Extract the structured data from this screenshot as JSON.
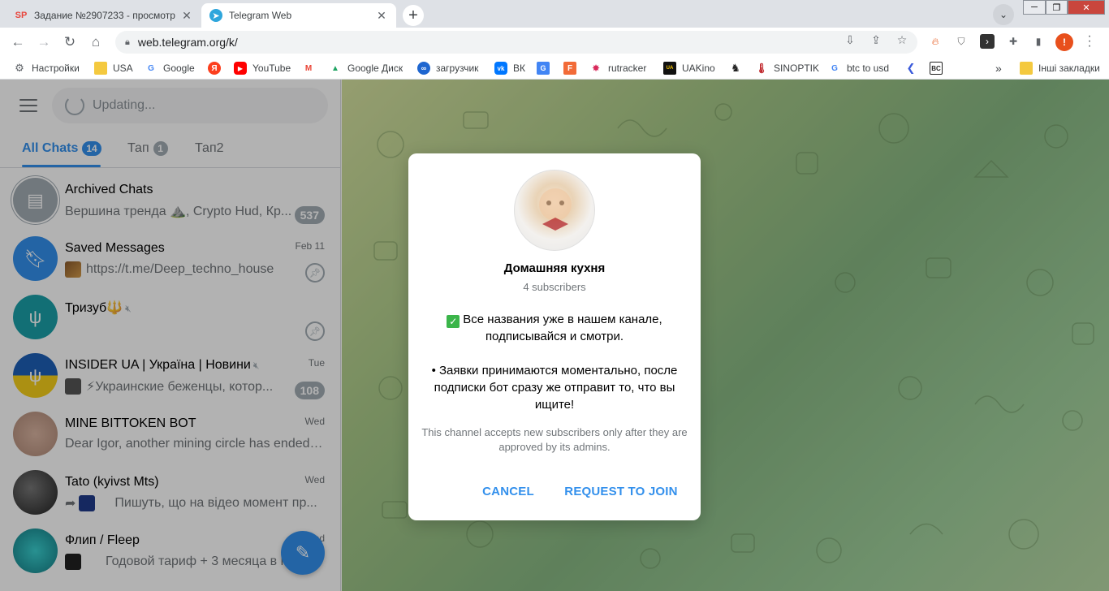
{
  "browser": {
    "tabs": [
      {
        "favicon": "SP",
        "title": "Задание №2907233 - просмотр",
        "active": false
      },
      {
        "favicon": "telegram-icon",
        "title": "Telegram Web",
        "active": true
      }
    ],
    "url": "web.telegram.org/k/",
    "profile_initial": "!",
    "bookmarks": [
      {
        "icon": "gear-icon",
        "label": "Настройки"
      },
      {
        "icon": "folder-icon",
        "label": "USA"
      },
      {
        "icon": "google-icon",
        "label": "Google"
      },
      {
        "icon": "yandex-icon",
        "label": ""
      },
      {
        "icon": "youtube-icon",
        "label": "YouTube"
      },
      {
        "icon": "gmail-icon",
        "label": ""
      },
      {
        "icon": "drive-icon",
        "label": "Google Диск"
      },
      {
        "icon": "loader-icon",
        "label": "загрузчик"
      },
      {
        "icon": "vk-icon",
        "label": "ВК"
      },
      {
        "icon": "translate-icon",
        "label": ""
      },
      {
        "icon": "f-icon",
        "label": ""
      },
      {
        "icon": "rutracker-icon",
        "label": "rutracker"
      },
      {
        "icon": "uakino-icon",
        "label": "UAKino"
      },
      {
        "icon": "chess-icon",
        "label": ""
      },
      {
        "icon": "thermometer-icon",
        "label": "SINOPTIK"
      },
      {
        "icon": "google-icon",
        "label": "btc to usd"
      },
      {
        "icon": "arrow-icon",
        "label": ""
      },
      {
        "icon": "bc-icon",
        "label": "BC"
      }
    ],
    "other_bookmarks": "Інші закладки"
  },
  "sidebar": {
    "search_placeholder": "Updating...",
    "folders": [
      {
        "label": "All Chats",
        "badge": "14",
        "active": true
      },
      {
        "label": "Тап",
        "badge": "1",
        "active": false
      },
      {
        "label": "Тап2",
        "badge": "",
        "active": false
      }
    ],
    "chats": [
      {
        "name": "Archived Chats",
        "preview": "Вершина тренда ⛰️, Crypto Hud, Кр...",
        "time": "",
        "count": "537",
        "pinned": false,
        "avatar_color": "#a2acb4"
      },
      {
        "name": "Saved Messages",
        "preview": "https://t.me/Deep_techno_house",
        "time": "Feb 11",
        "count": "",
        "pinned": true,
        "avatar_color": "#3390ec"
      },
      {
        "name": "Тризуб🔱",
        "preview": "",
        "time": "",
        "count": "",
        "pinned": true,
        "avatar_color": "#1a9fa8"
      },
      {
        "name": "INSIDER UA | Україна | Новини",
        "preview": "⚡Украинские беженцы, котор...",
        "time": "Tue",
        "count": "108",
        "pinned": false,
        "avatar_color": "#1d5fb6"
      },
      {
        "name": "MINE BITTOKEN BOT",
        "preview": "Dear Igor, another mining circle has ended! ...",
        "time": "Wed",
        "count": "",
        "pinned": false,
        "avatar_color": "#c9a089"
      },
      {
        "name": "Tato (kyivst Mts)",
        "preview": "Пишуть, що на відео момент пр...",
        "time": "Wed",
        "count": "",
        "pinned": false,
        "avatar_color": "#3a3a3a"
      },
      {
        "name": "Флип / Fleep",
        "preview": "Годовой тариф + 3 месяца в п...",
        "time": "Wed",
        "count": "",
        "pinned": false,
        "avatar_color": "#2aa6a8"
      }
    ]
  },
  "modal": {
    "title": "Домашняя кухня",
    "subtitle": "4 subscribers",
    "description": "Все названия уже в нашем канале, подписывайся и смотри.\n\n• Заявки принимаются моментально, после подписки бот сразу же отправит то, что вы ищите!",
    "note": "This channel accepts new subscribers only after they are approved by its admins.",
    "cancel_label": "CANCEL",
    "join_label": "REQUEST TO JOIN"
  },
  "colors": {
    "accent": "#3390ec",
    "badge_muted": "#a2acb4"
  }
}
